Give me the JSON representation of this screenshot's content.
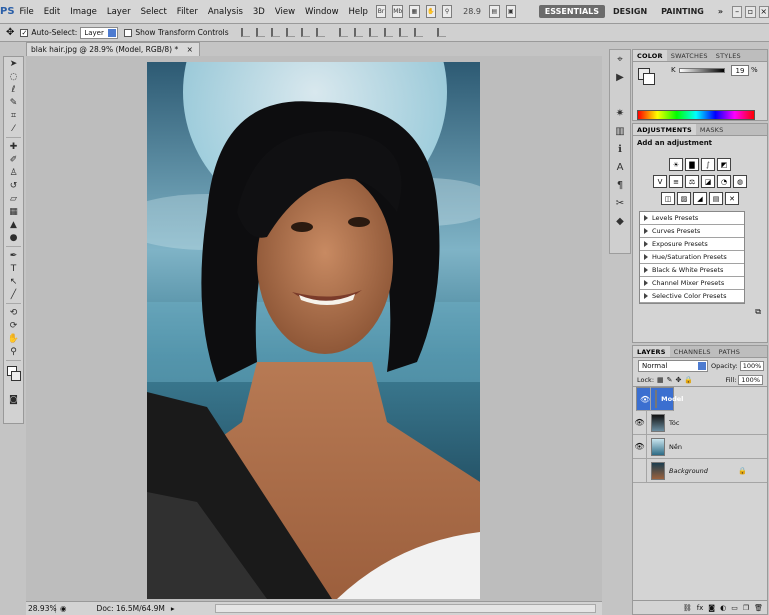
{
  "app": {
    "logo": "PS",
    "menus": [
      "File",
      "Edit",
      "Image",
      "Layer",
      "Select",
      "Filter",
      "Analysis",
      "3D",
      "View",
      "Window",
      "Help"
    ],
    "menu_icons": [
      "Br",
      "Mb"
    ],
    "zoom_value": "28.9",
    "workspaces": [
      "ESSENTIALS",
      "DESIGN",
      "PAINTING"
    ],
    "workspace_more": "»"
  },
  "options_bar": {
    "auto_select_label": "Auto-Select:",
    "auto_select_value": "Layer",
    "show_transform_label": "Show Transform Controls",
    "auto_select_checked": "✓"
  },
  "document": {
    "tab_title": "blak hair.jpg @ 28.9% (Model, RGB/8) *",
    "close": "×",
    "zoom_status": "28.93%",
    "doc_status": "Doc: 16.5M/64.9M"
  },
  "color_panel": {
    "tabs": [
      "COLOR",
      "SWATCHES",
      "STYLES"
    ],
    "channel_label": "K",
    "channel_value": "19"
  },
  "adjustments_panel": {
    "tabs": [
      "ADJUSTMENTS",
      "MASKS"
    ],
    "heading": "Add an adjustment",
    "presets": [
      "Levels Presets",
      "Curves Presets",
      "Exposure Presets",
      "Hue/Saturation Presets",
      "Black & White Presets",
      "Channel Mixer Presets",
      "Selective Color Presets"
    ]
  },
  "layers_panel": {
    "tabs": [
      "LAYERS",
      "CHANNELS",
      "PATHS"
    ],
    "blend_mode": "Normal",
    "opacity_label": "Opacity:",
    "opacity_value": "100%",
    "lock_label": "Lock:",
    "fill_label": "Fill:",
    "fill_value": "100%",
    "layers": [
      {
        "name": "Model",
        "selected": true,
        "visible": true
      },
      {
        "name": "Tóc",
        "selected": false,
        "visible": true
      },
      {
        "name": "Nền",
        "selected": false,
        "visible": true
      },
      {
        "name": "Background",
        "selected": false,
        "visible": false
      }
    ]
  },
  "colors": {
    "selection": "#3b6fd0",
    "ui_gray": "#d4d4d4"
  }
}
